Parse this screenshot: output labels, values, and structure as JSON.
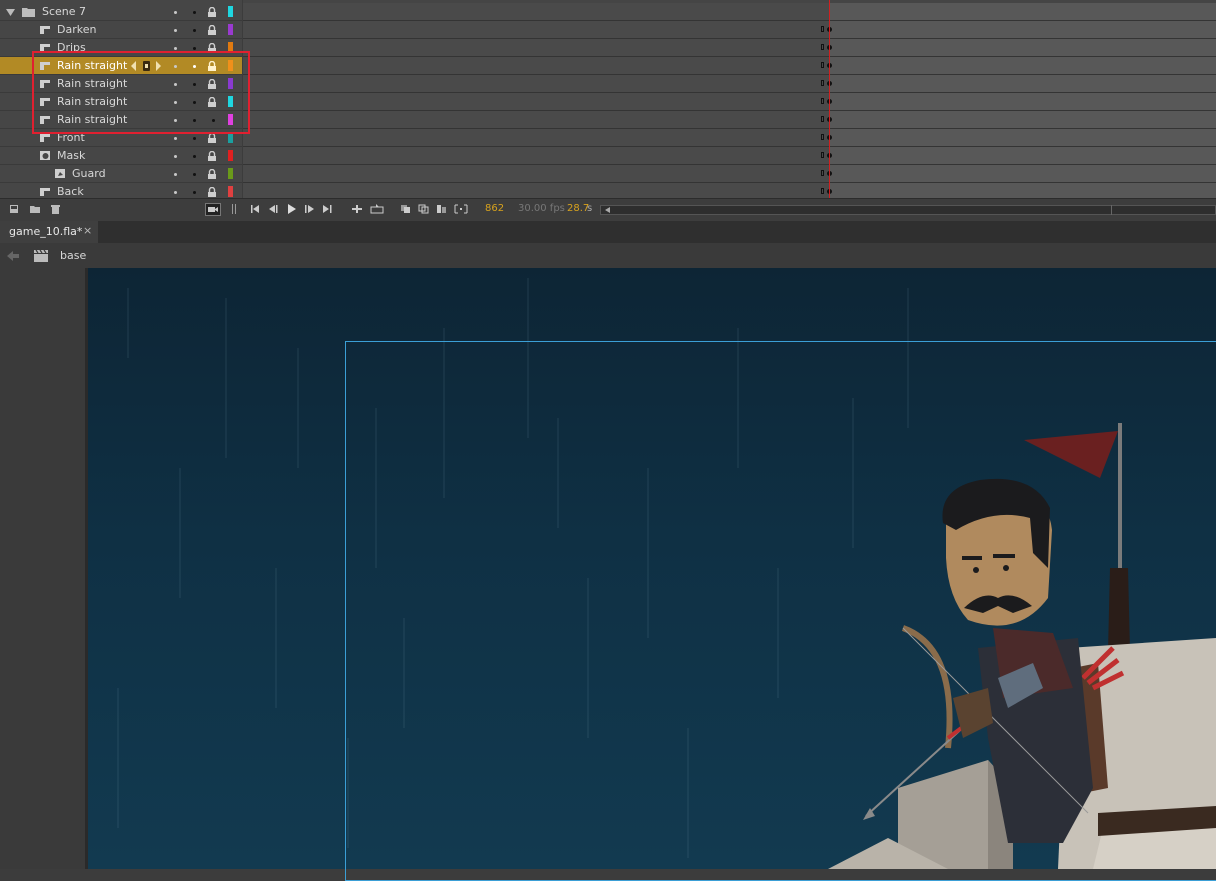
{
  "layers": {
    "rows": [
      {
        "label": "Scene 7",
        "kind": "folder",
        "expanded": true,
        "color": "#1fd6e0",
        "indent": 0
      },
      {
        "label": "Darken",
        "kind": "layer",
        "color": "#9a3ad0",
        "indent": 1
      },
      {
        "label": "Drips",
        "kind": "layer",
        "color": "#e07a10",
        "indent": 1
      },
      {
        "label": "Rain straight",
        "kind": "layer",
        "color": "#f0901a",
        "indent": 1,
        "selected": true
      },
      {
        "label": "Rain straight",
        "kind": "layer",
        "color": "#8a3ad0",
        "indent": 1
      },
      {
        "label": "Rain straight",
        "kind": "layer",
        "color": "#1fd6e0",
        "indent": 1
      },
      {
        "label": "Rain straight",
        "kind": "layer",
        "color": "#e040e0",
        "indent": 1
      },
      {
        "label": "Front",
        "kind": "layer",
        "color": "#1aa0a0",
        "indent": 1
      },
      {
        "label": "Mask",
        "kind": "mask",
        "color": "#e02020",
        "indent": 1
      },
      {
        "label": "Guard",
        "kind": "masked",
        "color": "#6a9a1a",
        "indent": 2
      },
      {
        "label": "Back",
        "kind": "layer",
        "color": "#e04040",
        "indent": 1
      }
    ]
  },
  "timeline": {
    "current_frame": "862",
    "fps": "30.00 fps",
    "elapsed": "28.7",
    "elapsed_unit": "s"
  },
  "document": {
    "tab_label": "game_10.fla*",
    "close_glyph": "×",
    "breadcrumb": "base"
  },
  "colors": {
    "selection": "#b28a25",
    "highlight_box": "#e02030",
    "stage_border": "#3b9fd6",
    "accent_numbers": "#d7a21e"
  }
}
